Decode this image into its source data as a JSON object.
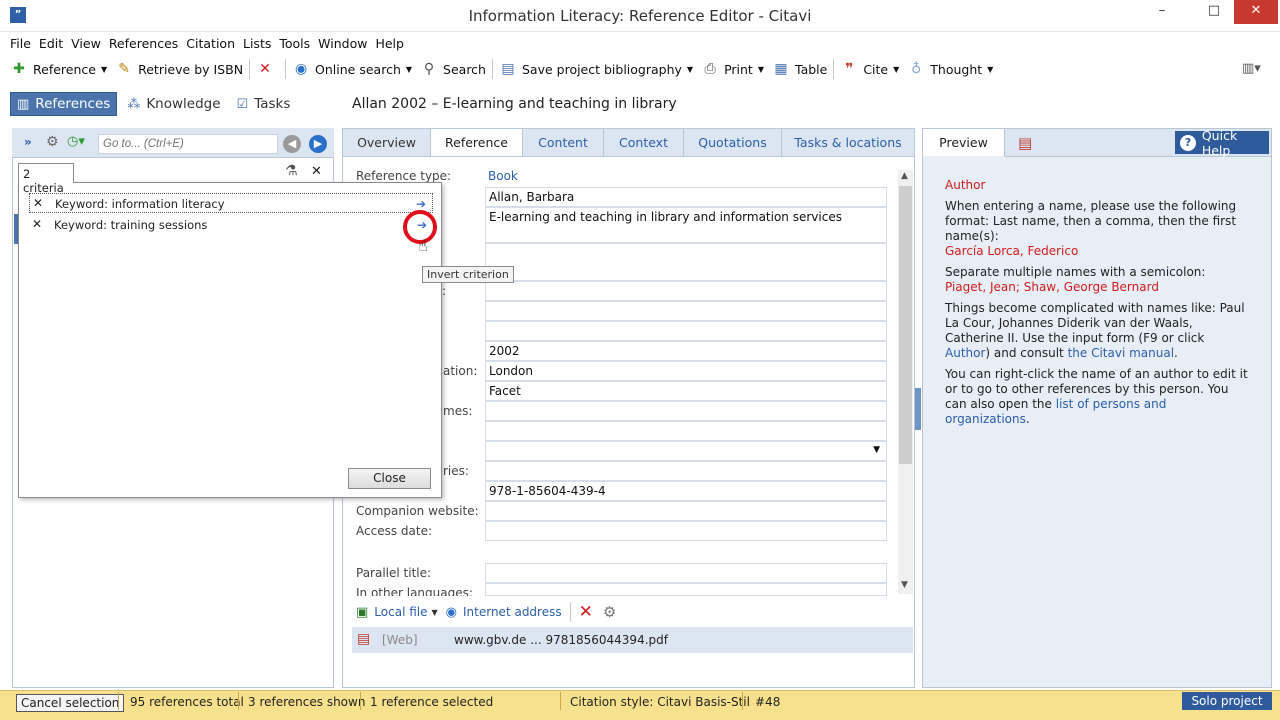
{
  "window": {
    "title": "Information Literacy: Reference Editor - Citavi",
    "minimize": "–",
    "maximize": "□",
    "close": "✕"
  },
  "menu": [
    "File",
    "Edit",
    "View",
    "References",
    "Citation",
    "Lists",
    "Tools",
    "Window",
    "Help"
  ],
  "toolbar": {
    "reference": "Reference",
    "retrieve": "Retrieve by ISBN",
    "online_search": "Online search",
    "search": "Search",
    "save_bib": "Save project bibliography",
    "print": "Print",
    "table": "Table",
    "cite": "Cite",
    "thought": "Thought"
  },
  "sections": {
    "references": "References",
    "knowledge": "Knowledge",
    "tasks": "Tasks"
  },
  "current_reference": "Allan 2002 – E-learning and teaching in library",
  "left": {
    "search_placeholder": "Go to... (Ctrl+E)",
    "criteria_tab": "2 criteria",
    "criteria": [
      "Keyword: information literacy",
      "Keyword: training sessions"
    ],
    "tooltip": "Invert criterion",
    "close": "Close"
  },
  "tabs": [
    "Overview",
    "Reference",
    "Content",
    "Context",
    "Quotations",
    "Tasks & locations"
  ],
  "fields": {
    "reference_type_label": "Reference type:",
    "reference_type": "Book",
    "author": "Allan, Barbara",
    "title": "E-learning and teaching in library and information services",
    "label_colon": ":",
    "year": "2002",
    "place_label_partial": "ation:",
    "place": "London",
    "publisher": "Facet",
    "editors_label_partial": "mes:",
    "series_label_partial": "ries:",
    "isbn": "978-1-85604-439-4",
    "companion_label": "Companion website:",
    "access_label": "Access date:",
    "parallel_label": "Parallel title:",
    "other_lang_label": "In other languages:"
  },
  "attachments": {
    "local_file": "Local file",
    "internet_address": "Internet address",
    "row_type": "[Web]",
    "row_address": "www.gbv.de ... 9781856044394.pdf"
  },
  "right": {
    "preview": "Preview",
    "quick_help": "Quick Help",
    "help_title": "Author",
    "p1": "When entering a name, please use the following format: Last name, then a comma, then the first name(s):",
    "p1_example": "García Lorca, Federico",
    "p2": "Separate multiple names with a semicolon:",
    "p2_example": "Piaget, Jean; Shaw, George Bernard",
    "p3a": "Things become complicated with names like: Paul La Cour, Johannes Diderik van der Waals, Catherine II. Use the input form (F9 or click ",
    "p3_link1": "Author",
    "p3b": ") and consult ",
    "p3_link2": "the Citavi manual",
    "p3c": ".",
    "p4a": "You can right-click the name of an author to edit it or to go to other references by this person. You can also open the ",
    "p4_link": "list of persons and organizations",
    "p4b": "."
  },
  "status": {
    "cancel": "Cancel selection",
    "total": "95 references total",
    "shown": "3 references shown",
    "selected": "1 reference selected",
    "style": "Citation style: Citavi Basis-Stil",
    "number": "#48",
    "project": "Solo project"
  }
}
